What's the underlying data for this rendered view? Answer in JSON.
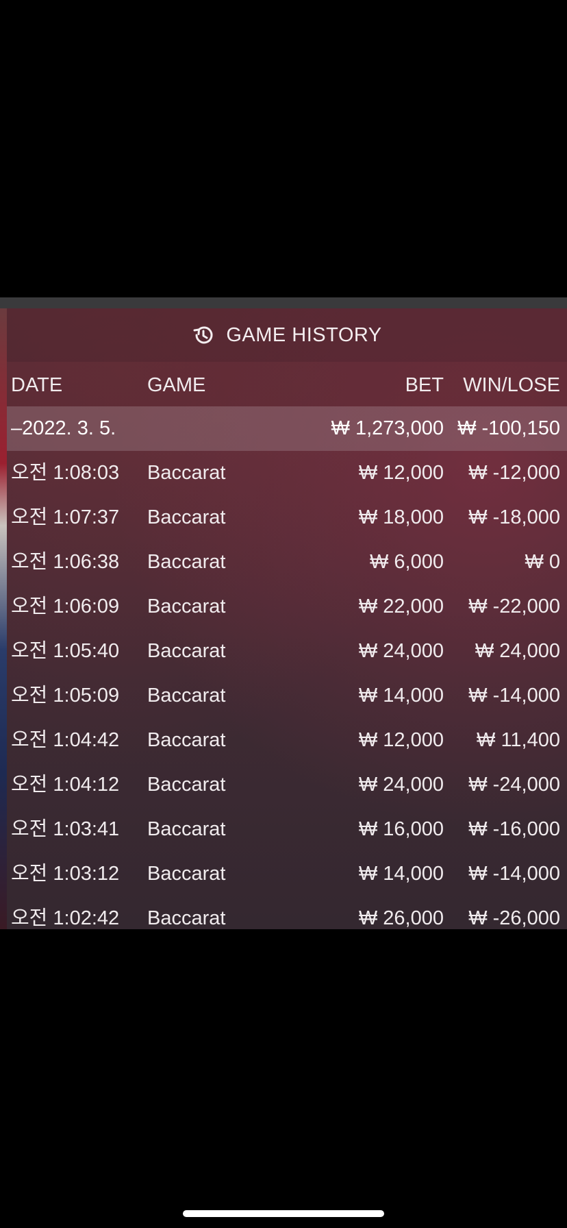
{
  "header": {
    "icon": "history-icon",
    "title": "GAME HISTORY"
  },
  "columns": {
    "date": "DATE",
    "game": "GAME",
    "bet": "BET",
    "win_lose": "WIN/LOSE"
  },
  "summary": {
    "date": "–2022. 3. 5.",
    "bet": "₩ 1,273,000",
    "win_lose": "₩ -100,150"
  },
  "rows": [
    {
      "time": "오전 1:08:03",
      "game": "Baccarat",
      "bet": "₩ 12,000",
      "win_lose": "₩ -12,000"
    },
    {
      "time": "오전 1:07:37",
      "game": "Baccarat",
      "bet": "₩ 18,000",
      "win_lose": "₩ -18,000"
    },
    {
      "time": "오전 1:06:38",
      "game": "Baccarat",
      "bet": "₩ 6,000",
      "win_lose": "₩ 0"
    },
    {
      "time": "오전 1:06:09",
      "game": "Baccarat",
      "bet": "₩ 22,000",
      "win_lose": "₩ -22,000"
    },
    {
      "time": "오전 1:05:40",
      "game": "Baccarat",
      "bet": "₩ 24,000",
      "win_lose": "₩ 24,000"
    },
    {
      "time": "오전 1:05:09",
      "game": "Baccarat",
      "bet": "₩ 14,000",
      "win_lose": "₩ -14,000"
    },
    {
      "time": "오전 1:04:42",
      "game": "Baccarat",
      "bet": "₩ 12,000",
      "win_lose": "₩ 11,400"
    },
    {
      "time": "오전 1:04:12",
      "game": "Baccarat",
      "bet": "₩ 24,000",
      "win_lose": "₩ -24,000"
    },
    {
      "time": "오전 1:03:41",
      "game": "Baccarat",
      "bet": "₩ 16,000",
      "win_lose": "₩ -16,000"
    },
    {
      "time": "오전 1:03:12",
      "game": "Baccarat",
      "bet": "₩ 14,000",
      "win_lose": "₩ -14,000"
    },
    {
      "time": "오전 1:02:42",
      "game": "Baccarat",
      "bet": "₩ 26,000",
      "win_lose": "₩ -26,000"
    }
  ]
}
